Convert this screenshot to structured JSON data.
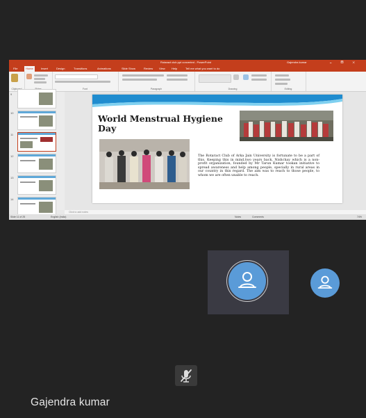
{
  "window": {
    "title": "Rotaract club ppt converted - PowerPoint",
    "user": "Gajendra kumar",
    "controls": "🗕 🗖 ✕"
  },
  "ribbon": {
    "tabs": [
      "File",
      "Home",
      "Insert",
      "Design",
      "Transitions",
      "Animations",
      "Slide Show",
      "Review",
      "View",
      "Help",
      "Tell me what you want to do"
    ],
    "active_tab": "Home",
    "groups": [
      "Clipboard",
      "Slides",
      "Font",
      "Paragraph",
      "Drawing",
      "Editing"
    ]
  },
  "thumbnails": {
    "numbers": [
      "9",
      "10",
      "11",
      "12",
      "13",
      "14"
    ],
    "selected": "11"
  },
  "slide": {
    "title": "World Menstrual Hygiene Day",
    "body": "The Rotaract Club of Arka Jain University is fortunate to be a part of this. Keeping this in mind,two years back, Nishchay which is a non-profit organization, founded by Mr Tarun Kumar tookan initiative to spread awareness and help among people, specially in rural areas in our country in this regard. The aim was to reach to those people, to whom we are often unable to reach."
  },
  "notes": {
    "placeholder": "Click to add notes"
  },
  "status": {
    "slide_count": "Slide 11 of 25",
    "language": "English (India)",
    "notes_btn": "Notes",
    "comments_btn": "Comments",
    "zoom": "74%"
  },
  "participant": {
    "name": "Gajendra kumar"
  },
  "colors": {
    "accent": "#c43e1c",
    "avatar": "#5a9bd8",
    "background": "#232323"
  }
}
